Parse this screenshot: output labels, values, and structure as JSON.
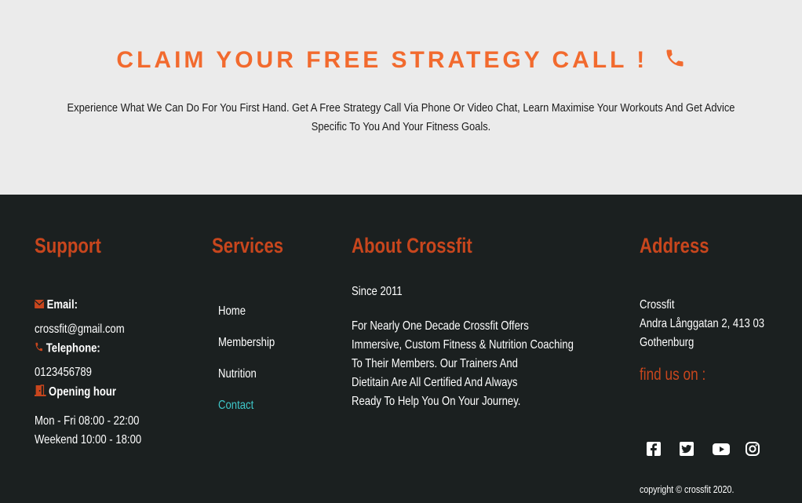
{
  "cta": {
    "title": "CLAIM YOUR FREE STRATEGY CALL !",
    "text": "Experience What We Can Do For You First Hand. Get A Free Strategy Call Via Phone Or Video Chat, Learn Maximise Your Workouts And Get Advice Specific To You And Your Fitness Goals."
  },
  "support": {
    "heading": "Support",
    "email_label": "Email:",
    "email": "crossfit@gmail.com",
    "phone_label": "Telephone:",
    "phone": "0123456789",
    "hours_label": "Opening hour",
    "hours_weekday": "Mon - Fri 08:00 - 22:00",
    "hours_weekend": "Weekend 10:00 - 18:00"
  },
  "services": {
    "heading": "Services",
    "links": [
      "Home",
      "Membership",
      "Nutrition",
      "Contact"
    ]
  },
  "about": {
    "heading": "About Crossfit",
    "since": "Since 2011",
    "lines": [
      "For Nearly One Decade Crossfit Offers",
      "Immersive, Custom Fitness & Nutrition Coaching",
      "To Their Members. Our Trainers And",
      "Dietitain Are All Certified And Always",
      "Ready To Help You On Your Journey."
    ]
  },
  "address": {
    "heading": "Address",
    "name": "Crossfit",
    "street": "Andra Långgatan 2, 413 03",
    "city": "Gothenburg",
    "find_us": "find us on :",
    "social_icons": [
      "facebook-icon",
      "twitter-icon",
      "youtube-icon",
      "instagram-icon"
    ],
    "copyright": "copyright © crossfit 2020."
  },
  "colors": {
    "accent_orange": "#f26a2e",
    "heading_rust": "#c8461d",
    "active_link": "#3ec7c9",
    "footer_bg": "#1b2020"
  }
}
